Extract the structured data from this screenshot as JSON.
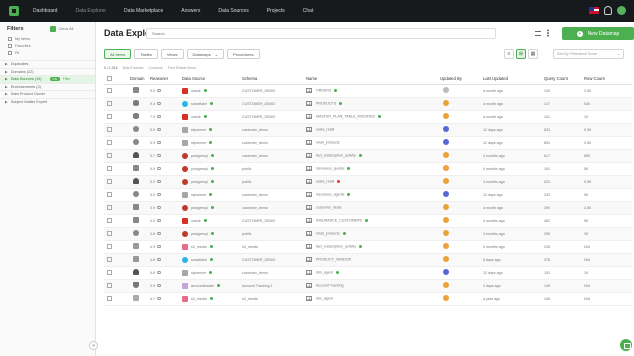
{
  "nav": {
    "items": [
      "Dashboard",
      "Data Explorer",
      "Data Marketplace",
      "Answers",
      "Data Sources",
      "Projects",
      "Chat"
    ]
  },
  "sidebar": {
    "title": "Filters",
    "clear_all": "Clear All",
    "checks": [
      "My items",
      "Favorites",
      "Pii"
    ],
    "sections": [
      {
        "label": "Duplicates",
        "active": false
      },
      {
        "label": "Domains (22)",
        "active": false
      },
      {
        "label": "Data Sources (19)",
        "active": true,
        "badge": "ON",
        "badge_text": "Filter"
      },
      {
        "label": "Endorsements (3)",
        "active": false
      },
      {
        "label": "Data Product Owner",
        "active": false
      },
      {
        "label": "Subject Matter Expert",
        "active": false
      }
    ]
  },
  "header": {
    "title": "Data Explorer",
    "search_placeholder": "Search",
    "new_button": "New Datamap"
  },
  "tabs": [
    {
      "label": "All Items",
      "active": true
    },
    {
      "label": "Tables",
      "active": false
    },
    {
      "label": "Views",
      "active": false
    },
    {
      "label": "Datamaps",
      "active": false,
      "dropdown": true
    },
    {
      "label": "Procedures",
      "active": false
    }
  ],
  "sort": {
    "placeholder": "Sort By: Relevance Score"
  },
  "selection": {
    "count": "0 / 1,014",
    "actions": [
      "Bulk Endorse",
      "Compare",
      "Find Similar Items"
    ]
  },
  "columns": [
    "Domain",
    "Reasoner",
    "Data Source",
    "Schema",
    "Name",
    "Updated By",
    "Last Updated",
    "Query Count",
    "Row Count"
  ],
  "rows": [
    {
      "domain_icon": "grid-icon",
      "reasoner": "9.0",
      "source": "oracle",
      "source_icon": "oracle",
      "source_status": "green",
      "schema": "CUSTOMER_DEMO",
      "name": "ORDERS",
      "name_status": "green",
      "user": "grey",
      "updated": "a month ago",
      "queries": "130",
      "rows": "3.5K"
    },
    {
      "domain_icon": "database-icon",
      "reasoner": "9.4",
      "source": "snowflake",
      "source_icon": "snowflake",
      "source_status": "green",
      "schema": "CUSTOMER_DEMO",
      "name": "PRODUCTS",
      "name_status": "green",
      "user": "orange",
      "updated": "a month ago",
      "queries": "147",
      "rows": "N/A"
    },
    {
      "domain_icon": "database-icon",
      "reasoner": "7.9",
      "source": "oracle",
      "source_icon": "oracle",
      "source_status": "green",
      "schema": "CUSTOMER_DEMO",
      "name": "MASTER_PLAN_TABLE_MODIFIED",
      "name_status": "green",
      "user": "orange",
      "updated": "a month ago",
      "queries": "161",
      "rows": "15"
    },
    {
      "domain_icon": "dollar-icon",
      "reasoner": "5.5",
      "source": "rdpserver",
      "source_icon": "mysql",
      "source_status": "green",
      "schema": "customer_demo",
      "name": "sales_retail",
      "name_status": "",
      "user": "blue",
      "updated": "12 days ago",
      "queries": "833",
      "rows": "5.5K"
    },
    {
      "domain_icon": "dollar-icon",
      "reasoner": "5.9",
      "source": "rdpserver",
      "source_icon": "mysql",
      "source_status": "green",
      "schema": "customer_demo",
      "name": "retail_products",
      "name_status": "",
      "user": "blue",
      "updated": "12 days ago",
      "queries": "853",
      "rows": "3.5K"
    },
    {
      "domain_icon": "person-icon",
      "reasoner": "5.7",
      "source": "postgresql",
      "source_icon": "postgresql",
      "source_status": "green",
      "schema": "customer_demo",
      "name": "fact_subscription_activity",
      "name_status": "green",
      "user": "orange",
      "updated": "4 months ago",
      "queries": "617",
      "rows": "89K"
    },
    {
      "domain_icon": "grid-icon",
      "reasoner": "9.9",
      "source": "postgresql",
      "source_icon": "postgresql",
      "source_status": "green",
      "schema": "public",
      "name": "insurance_quotes",
      "name_status": "green",
      "user": "orange",
      "updated": "4 months ago",
      "queries": "161",
      "rows": "5K"
    },
    {
      "domain_icon": "person-icon",
      "reasoner": "5.0",
      "source": "postgresql",
      "source_icon": "postgresql",
      "source_status": "green",
      "schema": "public",
      "name": "sales_retail",
      "name_status": "red",
      "user": "orange",
      "updated": "4 months ago",
      "queries": "523",
      "rows": "5.5K"
    },
    {
      "domain_icon": "dollar-icon",
      "reasoner": "5.0",
      "source": "rdpserver",
      "source_icon": "mysql",
      "source_status": "green",
      "schema": "customer_demo",
      "name": "insurance_agents",
      "name_status": "green",
      "user": "blue",
      "updated": "12 days ago",
      "queries": "333",
      "rows": "5K"
    },
    {
      "domain_icon": "grid-icon",
      "reasoner": "3.9",
      "source": "postgresql",
      "source_icon": "postgresql",
      "source_status": "green",
      "schema": "customer_demo",
      "name": "customer_deals",
      "name_status": "",
      "user": "orange",
      "updated": "a month ago",
      "queries": "399",
      "rows": "3.5K"
    },
    {
      "domain_icon": "grid-icon",
      "reasoner": "4.0",
      "source": "oracle",
      "source_icon": "oracle",
      "source_status": "green",
      "schema": "CUSTOMER_DEMO",
      "name": "INSURANCE_CUSTOMERS",
      "name_status": "green",
      "user": "orange",
      "updated": "4 months ago",
      "queries": "462",
      "rows": "5K"
    },
    {
      "domain_icon": "dollar-icon",
      "reasoner": "4.6",
      "source": "postgresql",
      "source_icon": "postgresql",
      "source_status": "green",
      "schema": "public",
      "name": "retail_products",
      "name_status": "green",
      "user": "orange",
      "updated": "4 months ago",
      "queries": "295",
      "rows": "3K"
    },
    {
      "domain_icon": "box-icon",
      "reasoner": "4.9",
      "source": "s3_media",
      "source_icon": "redshift",
      "source_status": "green",
      "schema": "s3_media",
      "name": "fact_subscription_activity",
      "name_status": "green",
      "user": "orange",
      "updated": "4 months ago",
      "queries": "235",
      "rows": "N/A"
    },
    {
      "domain_icon": "box-icon",
      "reasoner": "4.6",
      "source": "snowflake",
      "source_icon": "snowflake",
      "source_status": "green",
      "schema": "CUSTOMER_DEMO",
      "name": "PRODUCT_VENDOR",
      "name_status": "",
      "user": "orange",
      "updated": "8 days ago",
      "queries": "378",
      "rows": "N/A"
    },
    {
      "domain_icon": "person-icon",
      "reasoner": "4.8",
      "source": "rdpserver",
      "source_icon": "mysql",
      "source_status": "green",
      "schema": "customer_demo",
      "name": "dim_agent",
      "name_status": "green",
      "user": "blue",
      "updated": "12 days ago",
      "queries": "153",
      "rows": "1K"
    },
    {
      "domain_icon": "shield-icon",
      "reasoner": "3.9",
      "source": "accounttrackin",
      "source_icon": "s3",
      "source_status": "green",
      "schema": "Account Tracking 1",
      "name": "Account Tracking",
      "name_status": "",
      "user": "orange",
      "updated": "2 days ago",
      "queries": "149",
      "rows": "N/A"
    },
    {
      "domain_icon": "file-icon",
      "reasoner": "4.7",
      "source": "s3_media",
      "source_icon": "redshift",
      "source_status": "green",
      "schema": "s3_media",
      "name": "dim_agent",
      "name_status": "",
      "user": "orange",
      "updated": "a year ago",
      "queries": "146",
      "rows": "N/A"
    }
  ],
  "colors": {
    "accent": "#4caf50",
    "nav_bg": "#161a1d"
  }
}
